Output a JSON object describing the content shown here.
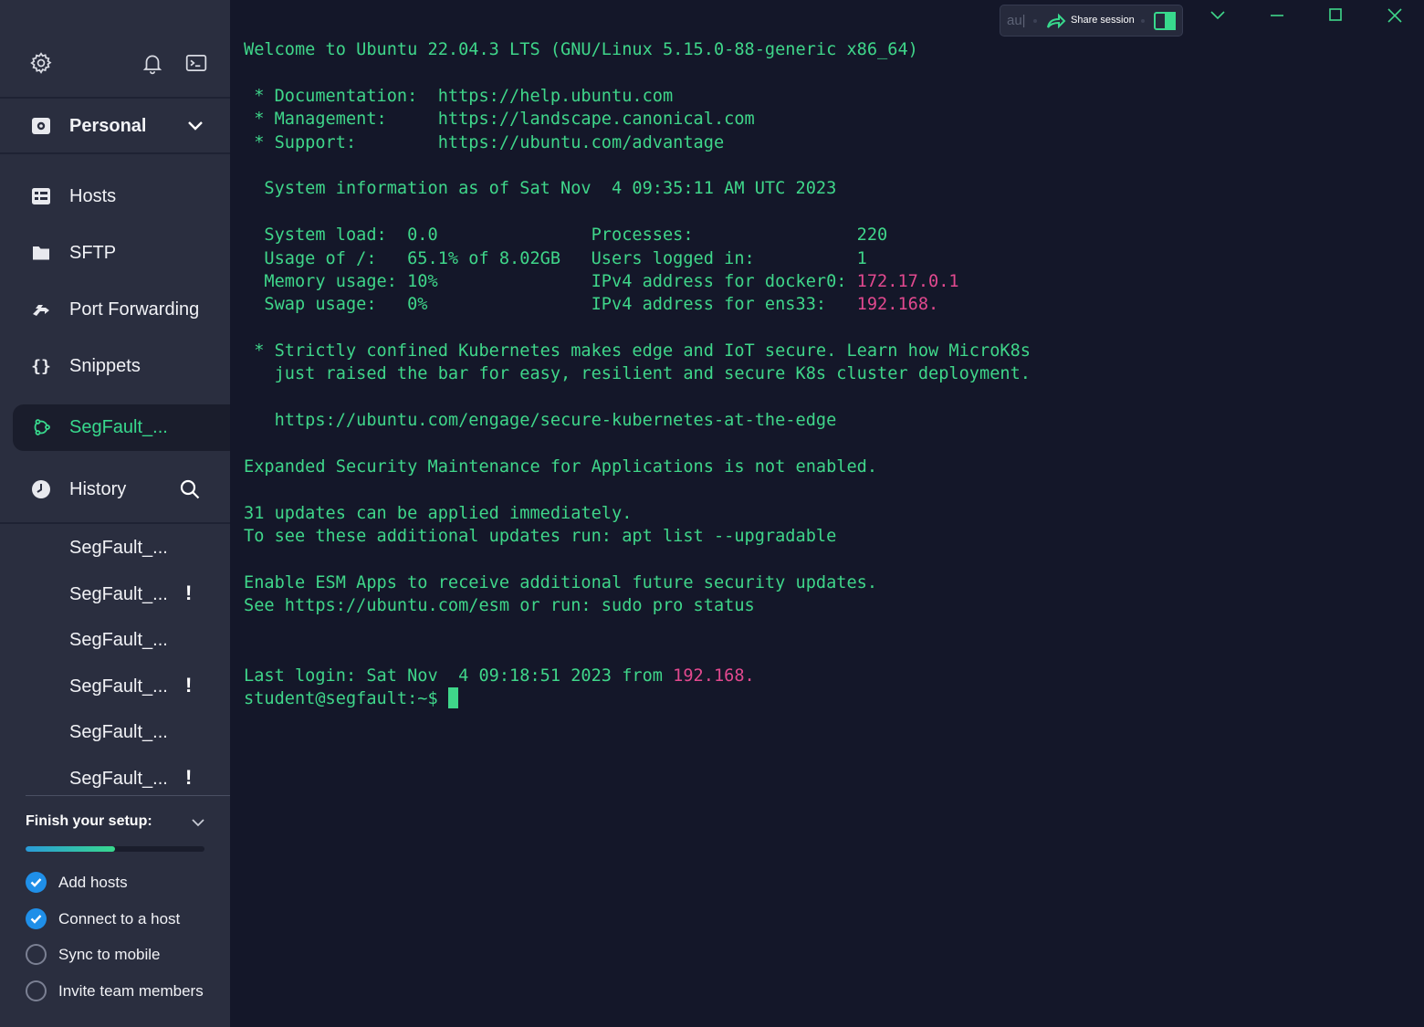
{
  "sidebar": {
    "top_icons": [
      "gear-icon",
      "bell-icon",
      "terminal-icon"
    ],
    "vault": {
      "label": "Personal",
      "icon": "vault-icon"
    },
    "nav": [
      {
        "label": "Hosts",
        "icon": "hosts-icon"
      },
      {
        "label": "SFTP",
        "icon": "folder-icon"
      },
      {
        "label": "Port Forwarding",
        "icon": "port-forwarding-icon"
      },
      {
        "label": "Snippets",
        "icon": "braces-icon"
      }
    ],
    "active_host": {
      "label": "SegFault_...",
      "icon": "ubuntu-icon"
    },
    "history": {
      "label": "History",
      "items": [
        {
          "label": "SegFault_...",
          "warning": ""
        },
        {
          "label": "SegFault_...",
          "warning": "!"
        },
        {
          "label": "SegFault_...",
          "warning": ""
        },
        {
          "label": "SegFault_...",
          "warning": "!"
        },
        {
          "label": "SegFault_...",
          "warning": ""
        },
        {
          "label": "SegFault_...",
          "warning": "!"
        }
      ]
    },
    "setup": {
      "title": "Finish your setup:",
      "progress": 0.5,
      "tasks": [
        {
          "label": "Add hosts",
          "done": true
        },
        {
          "label": "Connect to a host",
          "done": true
        },
        {
          "label": "Sync to mobile",
          "done": false
        },
        {
          "label": "Invite team members",
          "done": false
        }
      ]
    }
  },
  "toolbar": {
    "input_text": "au|",
    "share_label": "Share session"
  },
  "colors": {
    "terminal_text": "#3fd68a",
    "highlight": "#e2498f",
    "sidebar_bg": "#2a2e3f",
    "terminal_bg": "#141729",
    "accent_blue": "#1f8fe8"
  },
  "terminal": {
    "lines": [
      [
        {
          "t": "Welcome to Ubuntu 22.04.3 LTS (GNU/Linux 5.15.0-88-generic x86_64)"
        }
      ],
      [
        {
          "t": ""
        }
      ],
      [
        {
          "t": " * Documentation:  https://help.ubuntu.com"
        }
      ],
      [
        {
          "t": " * Management:     https://landscape.canonical.com"
        }
      ],
      [
        {
          "t": " * Support:        https://ubuntu.com/advantage"
        }
      ],
      [
        {
          "t": ""
        }
      ],
      [
        {
          "t": "  System information as of Sat Nov  4 09:35:11 AM UTC 2023"
        }
      ],
      [
        {
          "t": ""
        }
      ],
      [
        {
          "t": "  System load:  0.0               Processes:                220"
        }
      ],
      [
        {
          "t": "  Usage of /:   65.1% of 8.02GB   Users logged in:          1"
        }
      ],
      [
        {
          "t": "  Memory usage: 10%               IPv4 address for docker0: "
        },
        {
          "t": "172.17.0.1",
          "hl": true
        }
      ],
      [
        {
          "t": "  Swap usage:   0%                IPv4 address for ens33:   "
        },
        {
          "t": "192.168.",
          "hl": true
        }
      ],
      [
        {
          "t": ""
        }
      ],
      [
        {
          "t": " * Strictly confined Kubernetes makes edge and IoT secure. Learn how MicroK8s"
        }
      ],
      [
        {
          "t": "   just raised the bar for easy, resilient and secure K8s cluster deployment."
        }
      ],
      [
        {
          "t": ""
        }
      ],
      [
        {
          "t": "   https://ubuntu.com/engage/secure-kubernetes-at-the-edge"
        }
      ],
      [
        {
          "t": ""
        }
      ],
      [
        {
          "t": "Expanded Security Maintenance for Applications is not enabled."
        }
      ],
      [
        {
          "t": ""
        }
      ],
      [
        {
          "t": "31 updates can be applied immediately."
        }
      ],
      [
        {
          "t": "To see these additional updates run: apt list --upgradable"
        }
      ],
      [
        {
          "t": ""
        }
      ],
      [
        {
          "t": "Enable ESM Apps to receive additional future security updates."
        }
      ],
      [
        {
          "t": "See https://ubuntu.com/esm or run: sudo pro status"
        }
      ],
      [
        {
          "t": ""
        }
      ],
      [
        {
          "t": ""
        }
      ],
      [
        {
          "t": "Last login: Sat Nov  4 09:18:51 2023 from "
        },
        {
          "t": "192.168.",
          "hl": true
        }
      ],
      [
        {
          "t": "student@segfault:~$ "
        },
        {
          "cursor": true
        }
      ]
    ]
  }
}
